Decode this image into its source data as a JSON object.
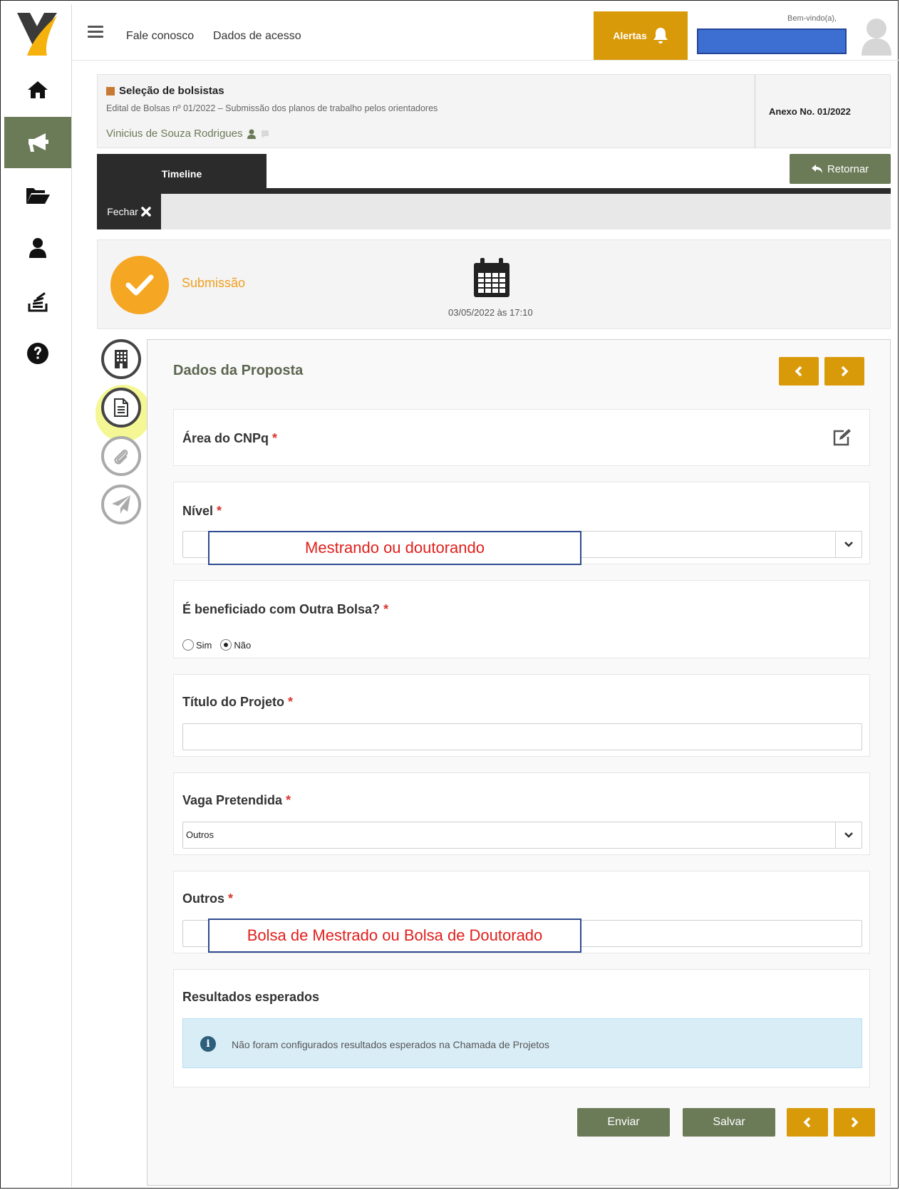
{
  "topbar": {
    "links": [
      "Fale conosco",
      "Dados de acesso"
    ],
    "alerts_label": "Alertas",
    "welcome": "Bem-vindo(a),"
  },
  "header": {
    "title": "Seleção de bolsistas",
    "subtitle": "Edital de Bolsas nº 01/2022 – Submissão dos planos de trabalho pelos orientadores",
    "person": "Vinicius de Souza Rodrigues",
    "annex": "Anexo No. 01/2022"
  },
  "tabs": {
    "timeline": "Timeline",
    "return": "Retornar",
    "close": "Fechar"
  },
  "timeline": {
    "step": "Submissão",
    "date": "03/05/2022 às 17:10"
  },
  "panel": {
    "title": "Dados da Proposta",
    "area_label": "Área do CNPq",
    "nivel_label": "Nível",
    "nivel_overlay": "Mestrando ou doutorando",
    "bolsa_label": "É beneficiado com Outra Bolsa?",
    "radio_options": [
      "Sim",
      "Não"
    ],
    "radio_selected": "Não",
    "titulo_label": "Título do Projeto",
    "titulo_value": "",
    "vaga_label": "Vaga Pretendida",
    "vaga_value": "Outros",
    "outros_label": "Outros",
    "outros_overlay": "Bolsa de Mestrado ou Bolsa de Doutorado",
    "resultados_label": "Resultados esperados",
    "resultados_info": "Não foram configurados resultados esperados na Chamada de Projetos",
    "required_mark": "*"
  },
  "footer": {
    "send": "Enviar",
    "save": "Salvar"
  },
  "colors": {
    "accent_orange": "#d99a0a",
    "olive_green": "#6b7a57",
    "dark": "#2b2b2b",
    "required": "#d9362c",
    "info_bg": "#d9edf7",
    "annotation_red": "#e0201c",
    "annotation_border": "#2f4a8f",
    "user_box": "#3c6fd1"
  },
  "icons": {
    "sidebar": [
      "home-icon",
      "megaphone-icon",
      "folder-open-icon",
      "user-icon",
      "stack-icon",
      "question-icon"
    ],
    "steps": [
      "building-icon",
      "document-icon",
      "paperclip-icon",
      "paper-plane-icon"
    ]
  }
}
